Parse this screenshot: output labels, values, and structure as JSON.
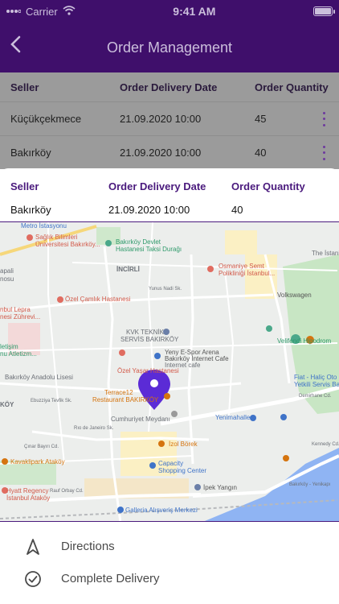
{
  "status_bar": {
    "carrier": "Carrier",
    "time": "9:41 AM"
  },
  "nav": {
    "title": "Order Management"
  },
  "table": {
    "headers": {
      "seller": "Seller",
      "date": "Order Delivery Date",
      "quantity": "Order Quantity"
    },
    "rows": [
      {
        "seller": "Küçükçekmece",
        "date": "21.09.2020 10:00",
        "quantity": "45"
      },
      {
        "seller": "Bakırköy",
        "date": "21.09.2020 10:00",
        "quantity": "40"
      }
    ]
  },
  "modal": {
    "headers": {
      "seller": "Seller",
      "date": "Order Delivery Date",
      "quantity": "Order Quantity"
    },
    "selected": {
      "seller": "Bakırköy",
      "date": "21.09.2020 10:00",
      "quantity": "40"
    },
    "map_labels": {
      "metro": "Metro İstasyonu",
      "saglik1": "Sağlık Bilimleri",
      "saglik2": "Üniversitesi Bakırköy...",
      "devlet1": "Bakırköy Devlet",
      "devlet2": "Hastanesi Taksi Durağı",
      "incirli": "İNCİRLİ",
      "osmaniye1": "Osmaniye Semt",
      "osmaniye2": "Polikliniği İstanbul...",
      "istanbul": "The İstanb",
      "apali1": "apali",
      "apali2": "nosu",
      "lepra1": "nbul Lepra",
      "lepra2": "nesi Zührevi...",
      "camlik": "Özel Çamlık Hastanesi",
      "volkswagen": "Volkswagen",
      "kvk1": "KVK TEKNİK",
      "kvk2": "SERVİS BAKIRKÖY",
      "velifendi": "Velifendi Hipodrom",
      "yeny1": "Yeny E-Spor Arena",
      "yeny2": "Bakırköy İnternet Cafe",
      "yeny3": "Internet cafe",
      "iletisim1": "letişim",
      "iletisim2": "nu Atletizm...",
      "yasar": "Özel Yaşar Hastanesi",
      "anadolu": "Bakırköy Anadolu Lisesi",
      "fiat1": "Fiat - Haliç Oto B",
      "fiat2": "Yetkili Servis Bay",
      "terrace1": "Terrace12",
      "terrace2": "Restaurant BAKIRKÖY",
      "koy": "KÖY",
      "yenimahalle": "Yenimahalle",
      "cumhuriyet": "Cumhuriyet Meydanı",
      "izol": "İzol Börek",
      "kavaklipark": "Kavaklipark Ataköy",
      "capacity1": "Capacity",
      "capacity2": "Shopping Center",
      "ipek": "İpek Yangın",
      "hyatt1": "Hyatt Regency",
      "hyatt2": "İstanbul Ataköy",
      "galleria": "Galleria Alışveriş Merkezi",
      "yunus": "Yunus Nadi Sk.",
      "demirhane": "Demirhane Cd.",
      "kennedy": "Kennedy Cd.",
      "rauf": "Rauf Orbay Cd.",
      "cinar": "Çınar Bayırı Cd.",
      "rio": "Rıo de Janeiro Sk.",
      "ebuzziya": "Ebuzziya Tevfik Sk.",
      "bakirkoy_yenikapi": "Bakırköy - Yenikapı"
    }
  },
  "actions": [
    {
      "label": "Directions",
      "icon": "navigation-arrow-icon"
    },
    {
      "label": "Complete Delivery",
      "icon": "check-circle-icon"
    }
  ],
  "colors": {
    "primary": "#4a1a7d",
    "header": "#3f0f6b",
    "pin": "#5b2bd6",
    "water": "#8fb4f3",
    "park": "#c8e6c4"
  }
}
